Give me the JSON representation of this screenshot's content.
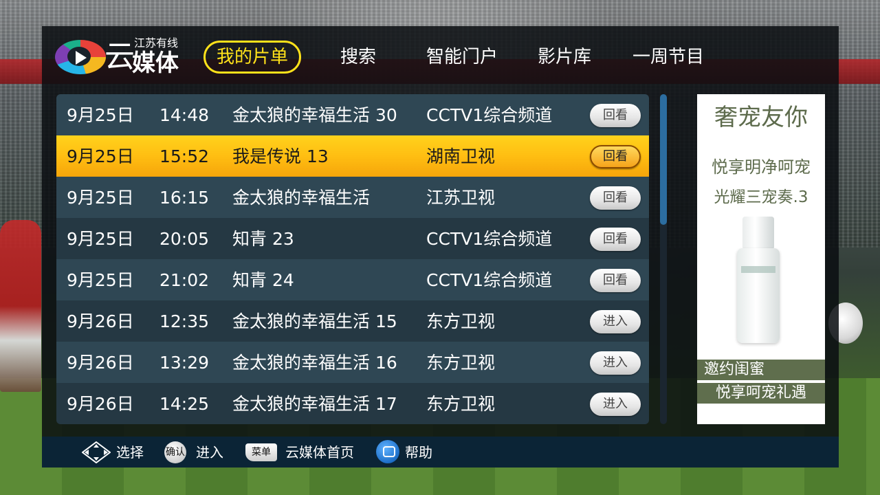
{
  "logo": {
    "sub": "江苏有线",
    "cloud_char": "云",
    "main": "媒体"
  },
  "nav": [
    "我的片单",
    "搜索",
    "智能门户",
    "影片库",
    "一周节目"
  ],
  "rows": [
    {
      "date": "9月25日",
      "time": "14:48",
      "title": "金太狼的幸福生活 30",
      "channel": "CCTV1综合频道",
      "action": "回看"
    },
    {
      "date": "9月25日",
      "time": "15:52",
      "title": "我是传说 13",
      "channel": "湖南卫视",
      "action": "回看"
    },
    {
      "date": "9月25日",
      "time": "16:15",
      "title": "金太狼的幸福生活",
      "channel": "江苏卫视",
      "action": "回看"
    },
    {
      "date": "9月25日",
      "time": "20:05",
      "title": "知青 23",
      "channel": "CCTV1综合频道",
      "action": "回看"
    },
    {
      "date": "9月25日",
      "time": "21:02",
      "title": "知青 24",
      "channel": "CCTV1综合频道",
      "action": "回看"
    },
    {
      "date": "9月26日",
      "time": "12:35",
      "title": "金太狼的幸福生活 15",
      "channel": "东方卫视",
      "action": "进入"
    },
    {
      "date": "9月26日",
      "time": "13:29",
      "title": "金太狼的幸福生活 16",
      "channel": "东方卫视",
      "action": "进入"
    },
    {
      "date": "9月26日",
      "time": "14:25",
      "title": "金太狼的幸福生活 17",
      "channel": "东方卫视",
      "action": "进入"
    }
  ],
  "selected_row": 1,
  "ad": {
    "headline": "奢宠友你",
    "line1": "悦享明净呵宠",
    "line2": "光耀三宠奏.3",
    "bar1": "邀约闺蜜",
    "bar2": "悦享呵宠礼遇"
  },
  "footer": {
    "select_label": "选择",
    "ok_icon_text": "确认",
    "enter_label": "进入",
    "menu_icon_text": "菜单",
    "home_label": "云媒体首页",
    "help_label": "帮助"
  }
}
